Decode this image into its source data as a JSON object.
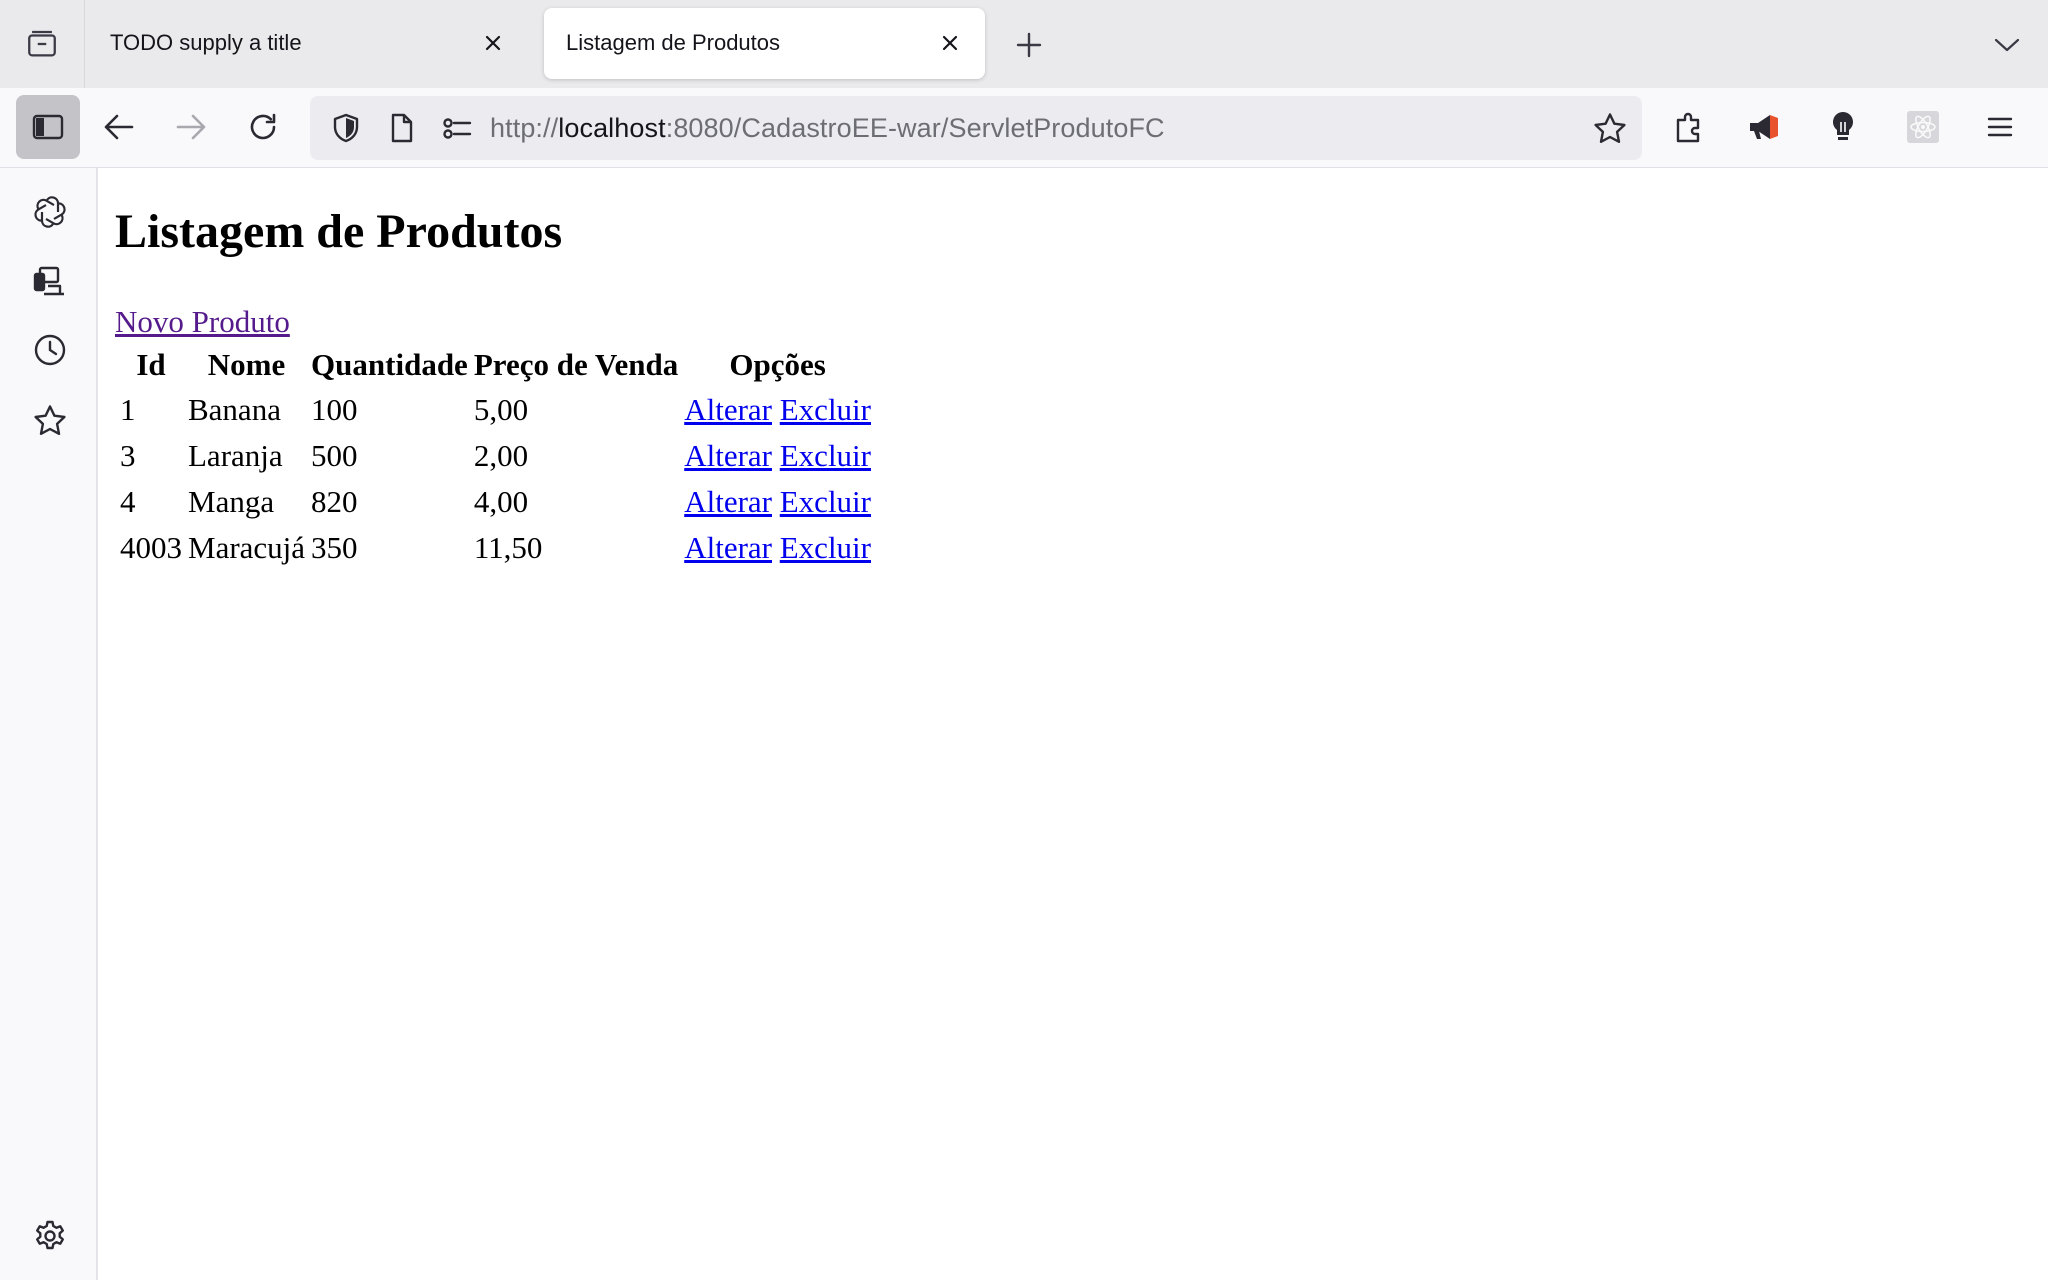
{
  "tabs": [
    {
      "title": "TODO supply a title",
      "active": false
    },
    {
      "title": "Listagem de Produtos",
      "active": true
    }
  ],
  "toolbar": {
    "url_prefix": "http://",
    "url_host": "localhost",
    "url_path": ":8080/CadastroEE-war/ServletProdutoFC"
  },
  "page": {
    "title": "Listagem de Produtos",
    "new_product_link": "Novo Produto",
    "table": {
      "headers": [
        "Id",
        "Nome",
        "Quantidade",
        "Preço de Venda",
        "Opções"
      ],
      "rows": [
        {
          "id": "1",
          "nome": "Banana",
          "quantidade": "100",
          "preco": "5,00",
          "alterar": "Alterar",
          "excluir": "Excluir"
        },
        {
          "id": "3",
          "nome": "Laranja",
          "quantidade": "500",
          "preco": "2,00",
          "alterar": "Alterar",
          "excluir": "Excluir"
        },
        {
          "id": "4",
          "nome": "Manga",
          "quantidade": "820",
          "preco": "4,00",
          "alterar": "Alterar",
          "excluir": "Excluir"
        },
        {
          "id": "4003",
          "nome": "Maracujá",
          "quantidade": "350",
          "preco": "11,50",
          "alterar": "Alterar",
          "excluir": "Excluir"
        }
      ]
    }
  },
  "colors": {
    "visited_link": "#551a8b",
    "link": "#0000ee",
    "tabbar_bg": "#eaeaed",
    "toolbar_bg": "#f9f9fb"
  }
}
